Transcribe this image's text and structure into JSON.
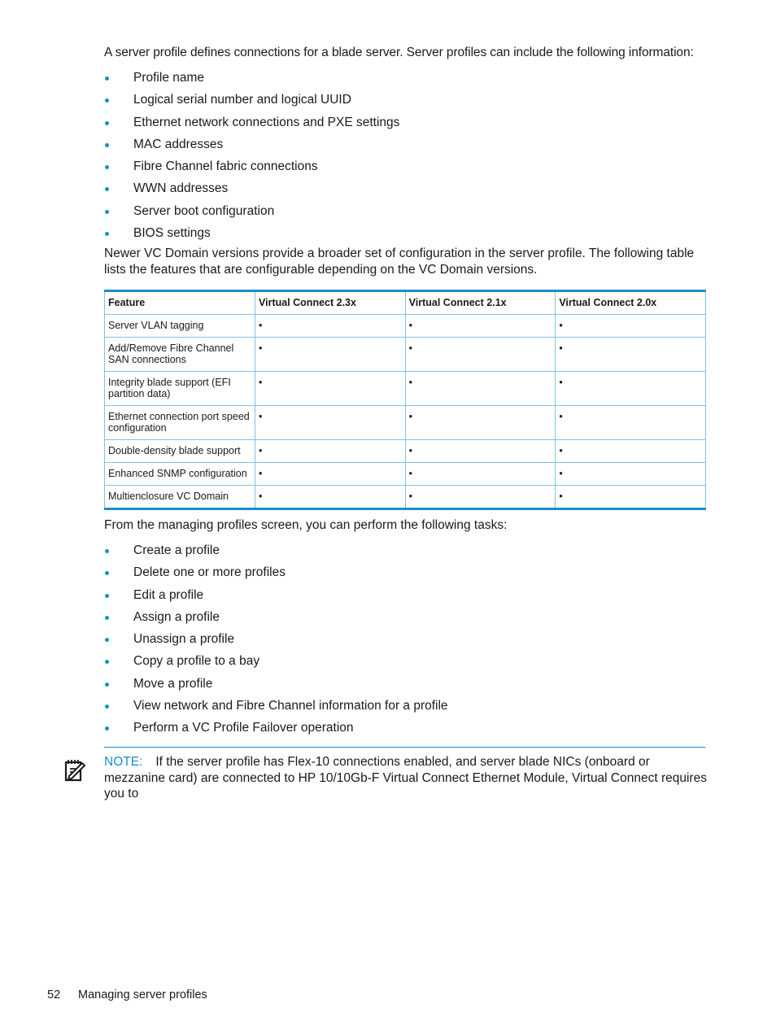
{
  "intro": "A server profile defines connections for a blade server. Server profiles can include the following information:",
  "profile_info_items": [
    "Profile name",
    "Logical serial number and logical UUID",
    "Ethernet network connections and PXE settings",
    "MAC addresses",
    "Fibre Channel fabric connections",
    "WWN addresses",
    "Server boot configuration",
    "BIOS settings"
  ],
  "versions_paragraph": "Newer VC Domain versions provide a broader set of configuration in the server profile. The following table lists the features that are configurable depending on the VC Domain versions.",
  "table": {
    "headers": [
      "Feature",
      "Virtual Connect 2.3x",
      "Virtual Connect 2.1x",
      "Virtual Connect 2.0x"
    ],
    "rows": [
      [
        "Server VLAN tagging",
        "•",
        "•",
        "•"
      ],
      [
        "Add/Remove Fibre Channel SAN connections",
        "•",
        "•",
        "•"
      ],
      [
        "Integrity blade support (EFI partition data)",
        "•",
        "•",
        "•"
      ],
      [
        "Ethernet connection port speed configuration",
        "•",
        "•",
        "•"
      ],
      [
        "Double-density blade support",
        "•",
        "•",
        "•"
      ],
      [
        "Enhanced SNMP configuration",
        "•",
        "•",
        "•"
      ],
      [
        "Multienclosure VC Domain",
        "•",
        "•",
        "•"
      ]
    ]
  },
  "tasks_intro": "From the managing profiles screen, you can perform the following tasks:",
  "task_items": [
    "Create a profile",
    "Delete one or more profiles",
    "Edit a profile",
    "Assign a profile",
    "Unassign a profile",
    "Copy a profile to a bay",
    "Move a profile",
    "View network and Fibre Channel information for a profile",
    "Perform a VC Profile Failover operation"
  ],
  "note": {
    "label": "NOTE:",
    "text": "If the server profile has Flex-10 connections enabled, and server blade NICs (onboard or mezzanine card) are connected to HP 10/10Gb-F Virtual Connect Ethernet Module, Virtual Connect requires you to"
  },
  "footer": {
    "page_number": "52",
    "section": "Managing server profiles"
  },
  "colors": {
    "accent": "#1a8fc9",
    "table_border": "#7fc3e3"
  }
}
